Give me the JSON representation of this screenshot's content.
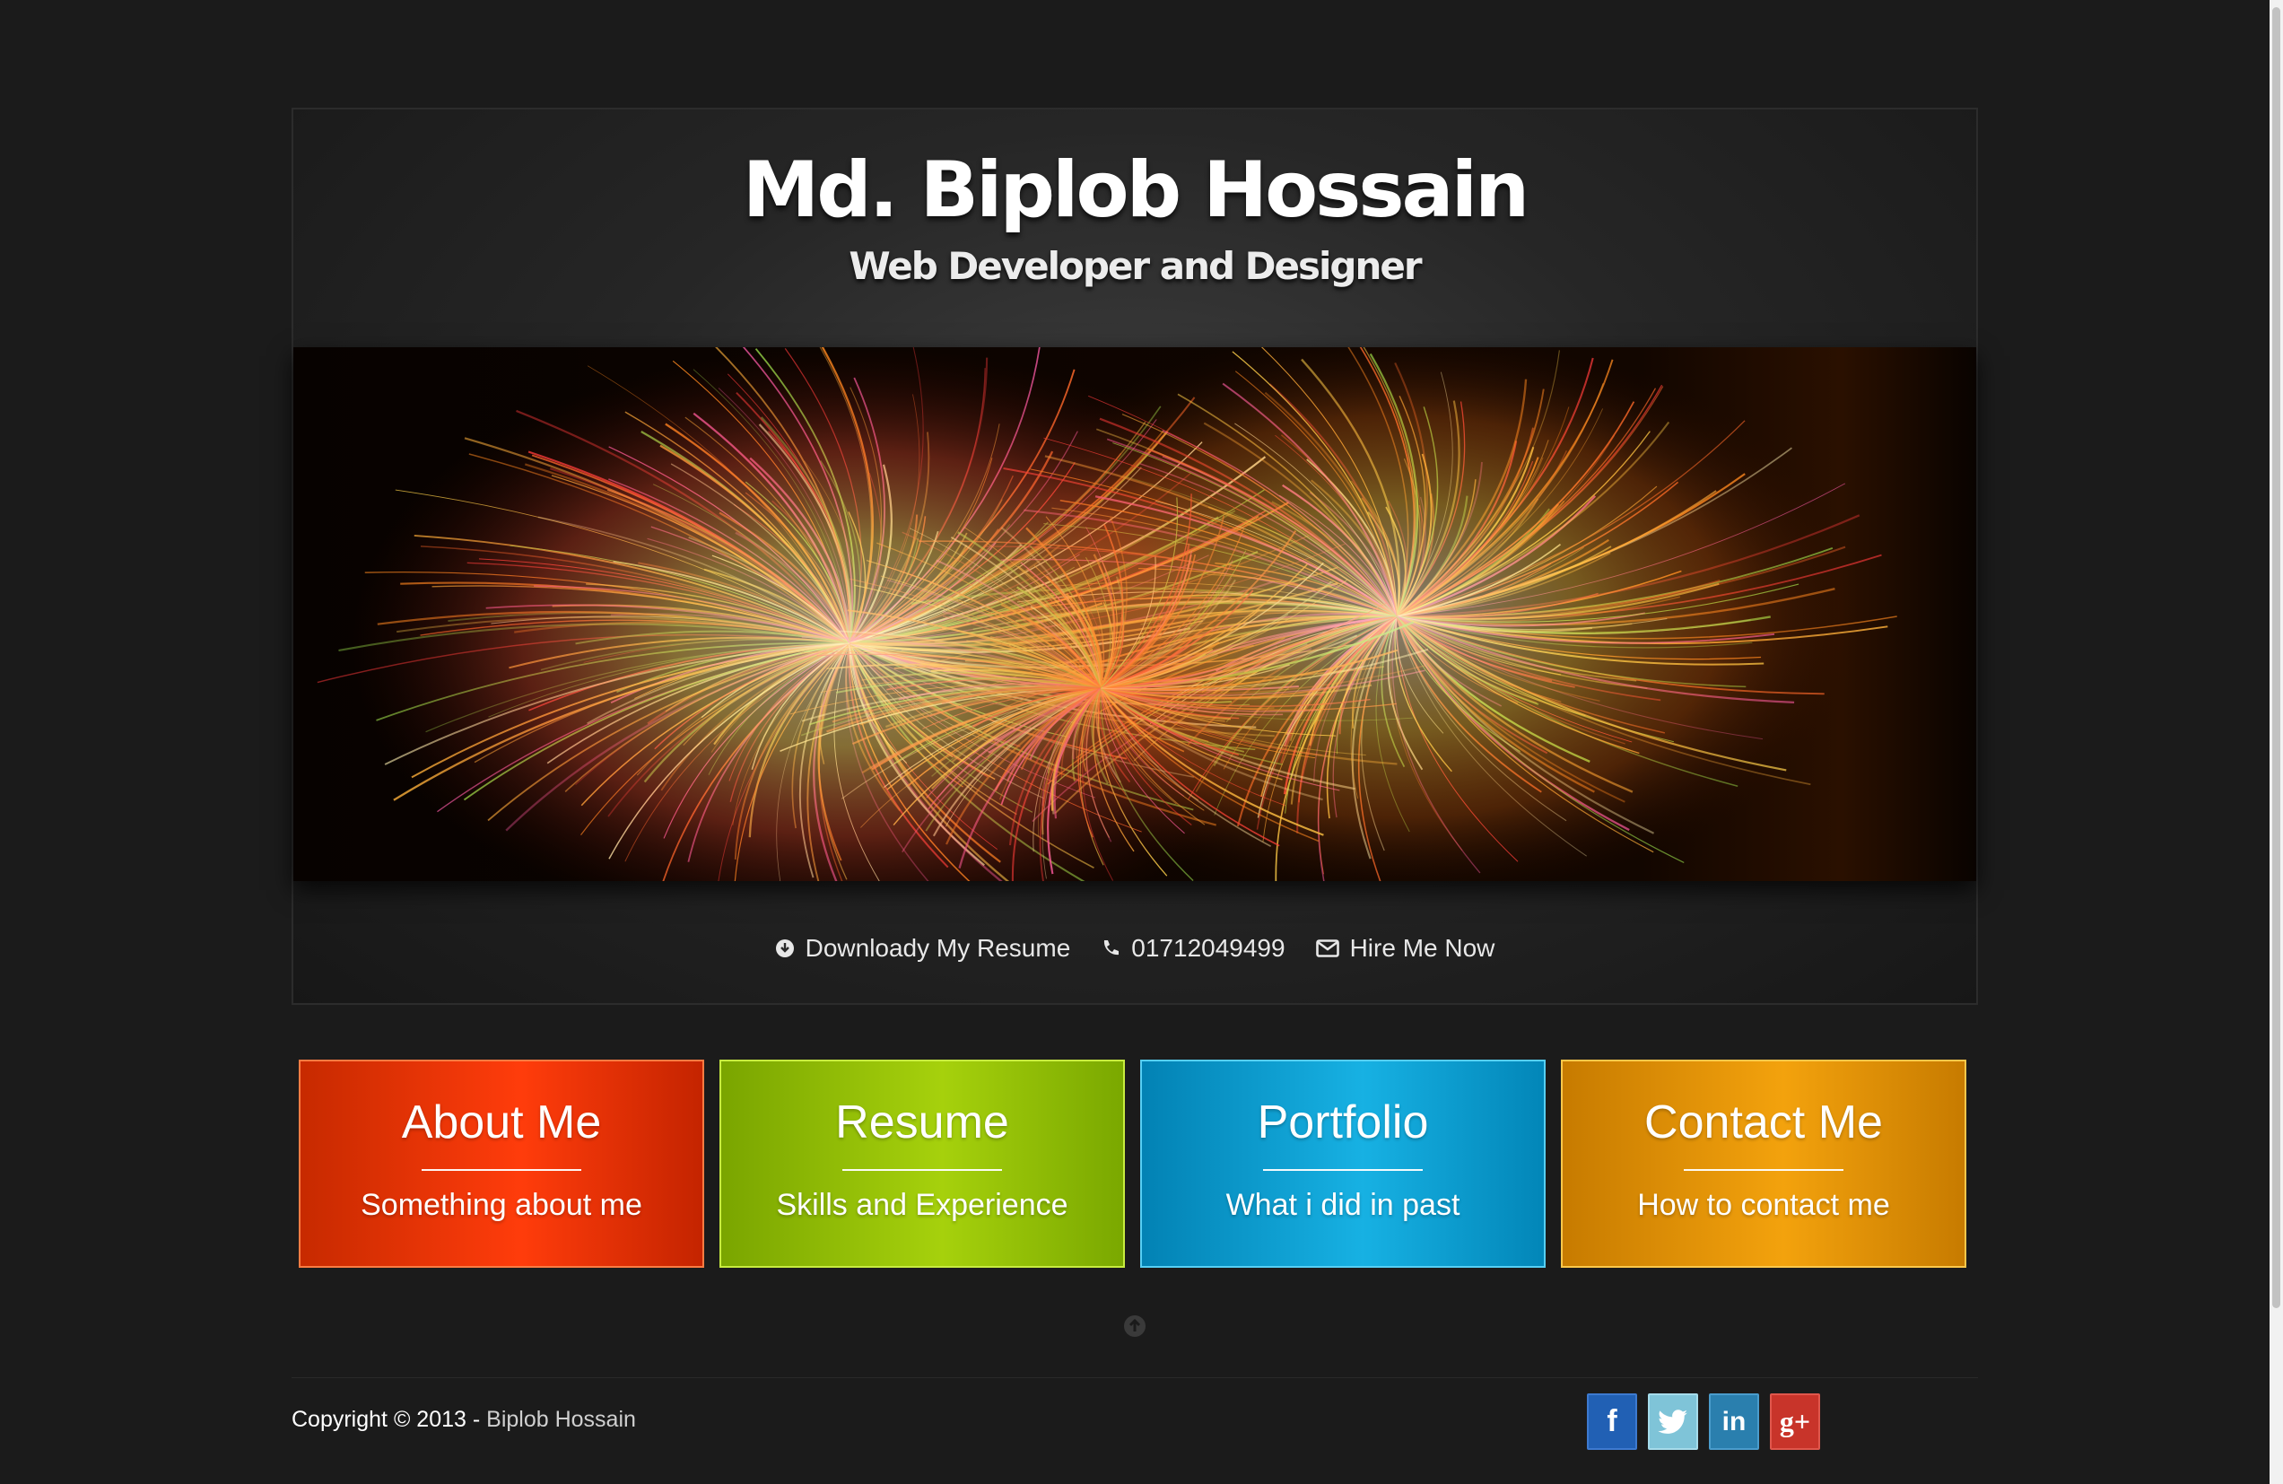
{
  "header": {
    "name": "Md. Biplob Hossain",
    "tagline": "Web Developer and Designer"
  },
  "banner": {
    "subject": "fireworks"
  },
  "contact_bar": {
    "resume_label": "Downloady My Resume",
    "phone": "01712049499",
    "hire_label": "Hire Me Now"
  },
  "tiles": [
    {
      "title": "About Me",
      "subtitle": "Something about me",
      "color": "#f03a0a"
    },
    {
      "title": "Resume",
      "subtitle": "Skills and Experience",
      "color": "#9ccb07"
    },
    {
      "title": "Portfolio",
      "subtitle": "What i did in past",
      "color": "#0ea7da"
    },
    {
      "title": "Contact Me",
      "subtitle": "How to contact me",
      "color": "#ea9b0a"
    }
  ],
  "footer": {
    "copyright_prefix": "Copyright © 2013 -",
    "copyright_name": "Biplob Hossain",
    "social": [
      {
        "icon": "facebook-icon",
        "glyph": "f",
        "color": "#2160b4"
      },
      {
        "icon": "twitter-icon",
        "glyph": "",
        "color": "#7fc4d8"
      },
      {
        "icon": "linkedin-icon",
        "glyph": "in",
        "color": "#2a7fae"
      },
      {
        "icon": "google-plus-icon",
        "glyph": "g+",
        "color": "#c8342a"
      }
    ]
  }
}
